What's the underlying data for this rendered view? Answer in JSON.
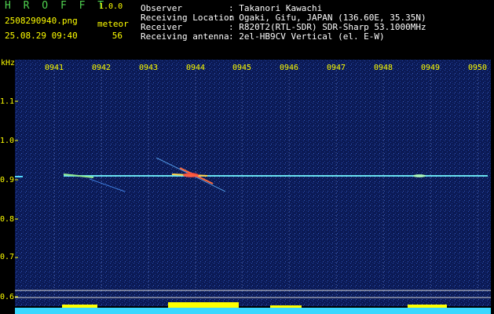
{
  "app": {
    "logo": "H R O F F T",
    "version": "1.0.0"
  },
  "capture": {
    "filename": "2508290940.png",
    "datetime": "25.08.29 09:40"
  },
  "meteor": {
    "label": "meteor",
    "count": "56"
  },
  "metadata": [
    {
      "label": "Observer",
      "value": ": Takanori Kawachi"
    },
    {
      "label": "Receiving Location",
      "value": ": Ogaki, Gifu, JAPAN (136.60E, 35.35N)"
    },
    {
      "label": "Receiver",
      "value": ": R820T2(RTL-SDR) SDR-Sharp 53.1000MHz"
    },
    {
      "label": "Receiving antenna",
      "value": ": 2el-HB9CV Vertical (el. E-W)"
    }
  ],
  "axis": {
    "y_unit": "kHz",
    "y_ticks": [
      "1.1",
      "1.0",
      "0.9",
      "0.8",
      "0.7",
      "0.6"
    ],
    "x_ticks": [
      "0941",
      "0942",
      "0943",
      "0944",
      "0945",
      "0946",
      "0947",
      "0948",
      "0949",
      "0950"
    ]
  },
  "colors": {
    "background": "#0b1a55",
    "signal": "#55d8ff",
    "label": "#ffff00"
  }
}
